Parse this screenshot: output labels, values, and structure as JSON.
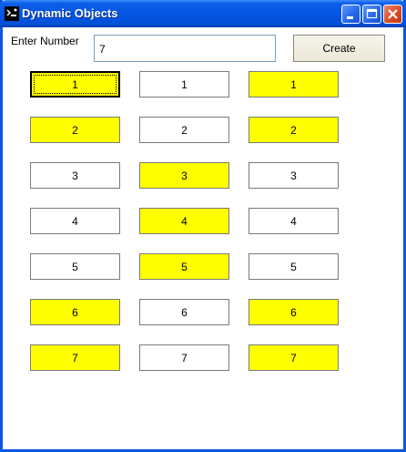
{
  "window": {
    "title": "Dynamic Objects",
    "app_icon": "app-icon",
    "controls": [
      "minimize-icon",
      "maximize-icon",
      "close-icon"
    ]
  },
  "form": {
    "label": "Enter Number",
    "input_value": "7",
    "create_label": "Create"
  },
  "colors": {
    "highlight": "#ffff00",
    "normal": "#ffffff",
    "title_bar": "#0555e4"
  },
  "grid": {
    "columns": 3,
    "rows": [
      {
        "cells": [
          {
            "label": "1",
            "color": "yellow",
            "focused": true
          },
          {
            "label": "1",
            "color": "white"
          },
          {
            "label": "1",
            "color": "yellow"
          }
        ]
      },
      {
        "cells": [
          {
            "label": "2",
            "color": "yellow"
          },
          {
            "label": "2",
            "color": "white"
          },
          {
            "label": "2",
            "color": "yellow"
          }
        ]
      },
      {
        "cells": [
          {
            "label": "3",
            "color": "white"
          },
          {
            "label": "3",
            "color": "yellow"
          },
          {
            "label": "3",
            "color": "white"
          }
        ]
      },
      {
        "cells": [
          {
            "label": "4",
            "color": "white"
          },
          {
            "label": "4",
            "color": "yellow"
          },
          {
            "label": "4",
            "color": "white"
          }
        ]
      },
      {
        "cells": [
          {
            "label": "5",
            "color": "white"
          },
          {
            "label": "5",
            "color": "yellow"
          },
          {
            "label": "5",
            "color": "white"
          }
        ]
      },
      {
        "cells": [
          {
            "label": "6",
            "color": "yellow"
          },
          {
            "label": "6",
            "color": "white"
          },
          {
            "label": "6",
            "color": "yellow"
          }
        ]
      },
      {
        "cells": [
          {
            "label": "7",
            "color": "yellow"
          },
          {
            "label": "7",
            "color": "white"
          },
          {
            "label": "7",
            "color": "yellow"
          }
        ]
      }
    ]
  }
}
